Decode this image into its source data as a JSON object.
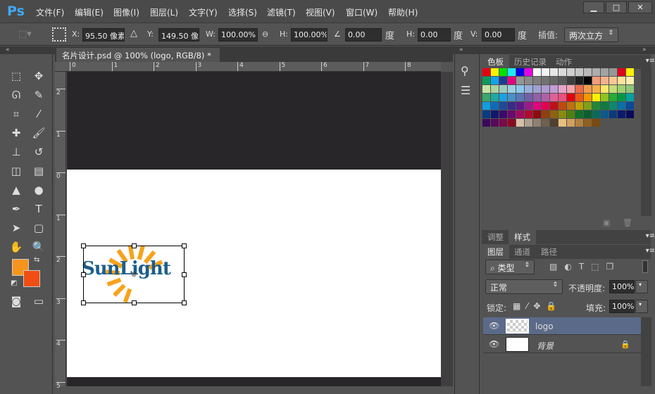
{
  "app": {
    "logo": "Ps",
    "menus": [
      "文件(F)",
      "编辑(E)",
      "图像(I)",
      "图层(L)",
      "文字(Y)",
      "选择(S)",
      "滤镜(T)",
      "视图(V)",
      "窗口(W)",
      "帮助(H)"
    ],
    "window_buttons": [
      "▁",
      "□",
      "✕"
    ]
  },
  "options": {
    "x_label": "X:",
    "x_value": "95.50 像素",
    "y_label": "Y:",
    "y_value": "149.50 像素",
    "w_label": "W:",
    "w_value": "100.00%",
    "h_label": "H:",
    "h_value": "100.00%",
    "angle_value": "0.00",
    "deg": "度",
    "hskew_label": "H:",
    "hskew_value": "0.00",
    "vskew_label": "V:",
    "vskew_value": "0.00",
    "interp_label": "插值:",
    "interp_value": "两次立方"
  },
  "document": {
    "tab_title": "名片设计.psd @ 100% (logo, RGB/8) *",
    "close": "×",
    "logo_text": "SunLight"
  },
  "rulers": {
    "top": [
      "0",
      "1",
      "2",
      "3",
      "4",
      "5",
      "6",
      "7",
      "8"
    ],
    "left": [
      "2",
      "1",
      "0",
      "1",
      "2",
      "3",
      "4",
      "5"
    ]
  },
  "colors": {
    "foreground": "#f7941d",
    "background": "#f04e14",
    "accent": "#3fa9f5",
    "logo_blue": "#1c5d8c",
    "logo_orange": "#f7a21b"
  },
  "swatches_panel": {
    "tabs": [
      "色板",
      "历史记录",
      "动作"
    ],
    "rows": [
      [
        "#e60012",
        "#fff100",
        "#00e000",
        "#1de9f9",
        "#0000e6",
        "#e600e6",
        "#ffffff",
        "#f2f2f2",
        "#e6e6e6",
        "#dadada",
        "#cfcfcf",
        "#c4c4c4",
        "#b8b8b8",
        "#adadad",
        "#a2a2a2",
        "#979797",
        "#e0001b",
        "#fff000"
      ],
      [
        "#0e9a58",
        "#10a4e8",
        "#1f3a93",
        "#e4007f",
        "#959595",
        "#8a8a8a",
        "#7e7e7e",
        "#727272",
        "#666666",
        "#595959",
        "#3e3e3e",
        "#1f1f1f",
        "#000000",
        "#f29c7c",
        "#f5b38a",
        "#f8c793",
        "#fde39c",
        "#fff0b0"
      ],
      [
        "#c8e3a8",
        "#a8d3a0",
        "#9ccbc0",
        "#9cd0e0",
        "#8cc8ec",
        "#98b0dc",
        "#a0a0d0",
        "#b09ad0",
        "#c09ed4",
        "#e8a4c8",
        "#f0a4b0",
        "#ec6a48",
        "#f09a50",
        "#f7b04c",
        "#fde66a",
        "#c4dc78",
        "#a0d070",
        "#8cc878"
      ],
      [
        "#3aa86a",
        "#20a8a0",
        "#1ca0e0",
        "#4a90c8",
        "#5a78b8",
        "#7060a8",
        "#9060a8",
        "#b060a8",
        "#e06098",
        "#e85080",
        "#e60012",
        "#ea5a14",
        "#f39800",
        "#fff100",
        "#8fc31f",
        "#22ac38",
        "#009944",
        "#00a0a0"
      ],
      [
        "#0f9ee0",
        "#0f6ab8",
        "#1d4a98",
        "#3a2a88",
        "#601888",
        "#9a1a88",
        "#e4007f",
        "#e4004f",
        "#c0101a",
        "#c04a10",
        "#c07010",
        "#c0a000",
        "#80a018",
        "#208838",
        "#107a40",
        "#0a8a6a",
        "#0a70a8",
        "#0a4a98"
      ],
      [
        "#0a3a80",
        "#101a6a",
        "#3a0a6a",
        "#6a0a6a",
        "#a00a60",
        "#b00a30",
        "#900a10",
        "#904010",
        "#906010",
        "#8a8a10",
        "#508010",
        "#107028",
        "#0a6030",
        "#0a6a5a",
        "#0a5a8a",
        "#0a3a7a",
        "#0a1a6a",
        "#0a0a5a"
      ],
      [
        "#3a0a5a",
        "#5a0a5a",
        "#7a0a4a",
        "#8a0a20",
        "#d8c0a8",
        "#b0a090",
        "#908070",
        "#706050",
        "#504030",
        "#e8c080",
        "#d0a060",
        "#b08040",
        "#906020",
        "#7a4a10"
      ]
    ]
  },
  "adjust_panel": {
    "tabs": [
      "调整",
      "样式"
    ]
  },
  "layers_panel": {
    "tabs": [
      "图层",
      "通道",
      "路径"
    ],
    "filter_kind": "类型",
    "blend_mode": "正常",
    "opacity_label": "不透明度:",
    "opacity_value": "100%",
    "lock_label": "锁定:",
    "fill_label": "填充:",
    "fill_value": "100%",
    "layers": [
      {
        "name": "logo",
        "selected": true
      },
      {
        "name": "背景",
        "selected": false,
        "locked": true
      }
    ]
  }
}
